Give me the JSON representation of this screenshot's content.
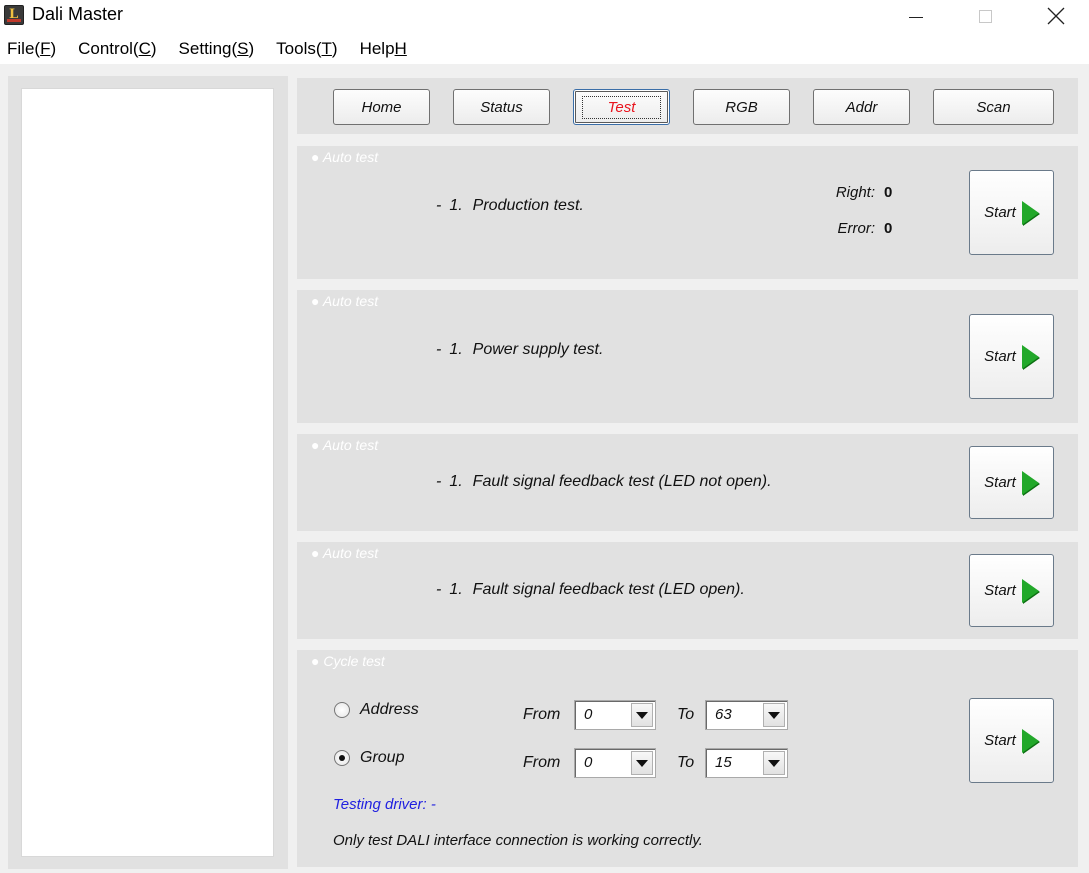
{
  "window": {
    "title": "Dali Master"
  },
  "menu": [
    {
      "label": "File(",
      "key": "F",
      "suffix": ")"
    },
    {
      "label": "Control(",
      "key": "C",
      "suffix": ")"
    },
    {
      "label": "Setting(",
      "key": "S",
      "suffix": ")"
    },
    {
      "label": "Tools(",
      "key": "T",
      "suffix": ")"
    },
    {
      "label": "Help",
      "key": "H",
      "suffix": ""
    }
  ],
  "tabs": {
    "home": "Home",
    "status": "Status",
    "test": "Test",
    "rgb": "RGB",
    "addr": "Addr",
    "scan": "Scan",
    "active": "test"
  },
  "sections": {
    "production": {
      "title": "● Auto test",
      "dash": "-",
      "num": "1.",
      "desc": "Production test.",
      "right_label": "Right:",
      "right_value": "0",
      "error_label": "Error:",
      "error_value": "0",
      "start": "Start"
    },
    "power": {
      "title": "● Auto test",
      "dash": "-",
      "num": "1.",
      "desc": "Power supply test.",
      "start": "Start"
    },
    "fault_not_open": {
      "title": "● Auto test",
      "dash": "-",
      "num": "1.",
      "desc": "Fault signal feedback test (LED not open).",
      "start": "Start"
    },
    "fault_open": {
      "title": "● Auto test",
      "dash": "-",
      "num": "1.",
      "desc": "Fault signal feedback test (LED open).",
      "start": "Start"
    },
    "cycle": {
      "title": "● Cycle test",
      "address_label": "Address",
      "group_label": "Group",
      "selected": "group",
      "from_label": "From",
      "to_label": "To",
      "address_from": "0",
      "address_to": "63",
      "group_from": "0",
      "group_to": "15",
      "testing_driver": "Testing driver: -",
      "note": "Only test DALI interface connection is working correctly.",
      "start": "Start"
    }
  },
  "colors": {
    "active_tab_text": "#e8141e",
    "play_icon": "#22a82a",
    "driver_text": "#1f1fe0",
    "section_bg": "#e1e1e1"
  }
}
